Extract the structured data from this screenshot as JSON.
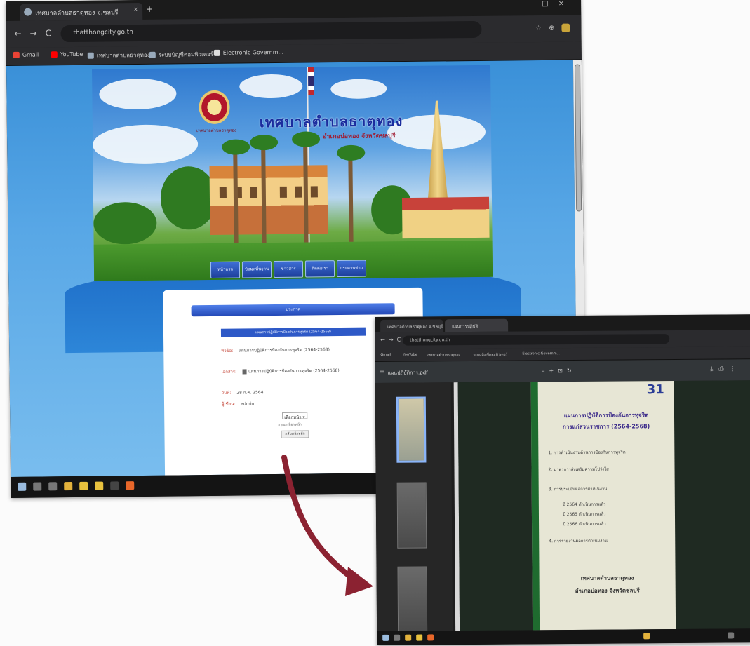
{
  "browser": {
    "tab_title": "เทศบาลตำบลธาตุทอง จ.ชลบุรี",
    "url": "thatthongcity.go.th",
    "bookmarks": [
      "Gmail",
      "YouTube",
      "เทศบาลตำบลธาตุทอง",
      "ระบบบัญชีคอมพิวเตอร์",
      "Electronic Governm..."
    ]
  },
  "site": {
    "title": "เทศบาลตำบลธาตุทอง",
    "subtitle": "อำเภอบ่อทอง จังหวัดชลบุรี",
    "seal_caption": "เทศบาลตำบลธาตุทอง",
    "menu": [
      "หน้าแรก",
      "ข้อมูลพื้นฐาน",
      "ข่าวสาร",
      "ติดต่อเรา",
      "กระดานข่าว"
    ],
    "section_header": "ประกาศ",
    "doc_header": "แผนการปฏิบัติการป้องกันการทุจริต (2564-2568)",
    "rows": [
      {
        "label": "หัวข้อ:",
        "value": "แผนการปฏิบัติการป้องกันการทุจริต (2564-2568)"
      },
      {
        "label": "เอกสาร:",
        "value": "แผนการปฏิบัติการป้องกันการทุจริต (2564-2568)"
      },
      {
        "label": "วันที่:",
        "value": "28 ก.ค. 2564"
      },
      {
        "label": "ผู้เขียน:",
        "value": "admin"
      }
    ],
    "select_value": "เลือกหน้า",
    "hint": "กรุณาเลือกหน้า",
    "back_button": "กลับหน้าหลัก"
  },
  "pdf_viewer": {
    "tab_title": "แผนการปฏิบัติ",
    "file_name": "แผนปฏิบัติการ.pdf",
    "page_number": "31",
    "doc_title_line1": "แผนการปฏิบัติการป้องกันการทุจริต",
    "doc_title_line2": "การแก่ส่วนราชการ (2564-2568)",
    "footer_line1": "เทศบาลตำบลธาตุทอง",
    "footer_line2": "อำเภอบ่อทอง จังหวัดชลบุรี",
    "body_lines": [
      "1. การดำเนินงานด้านการป้องกันการทุจริต",
      "2. มาตรการส่งเสริมความโปร่งใส",
      "3. การประเมินผลการดำเนินงาน",
      "ปี 2564 ดำเนินการแล้ว",
      "ปี 2565 ดำเนินการแล้ว",
      "ปี 2566 ดำเนินการแล้ว",
      "4. การรายงานผลการดำเนินงาน"
    ]
  }
}
